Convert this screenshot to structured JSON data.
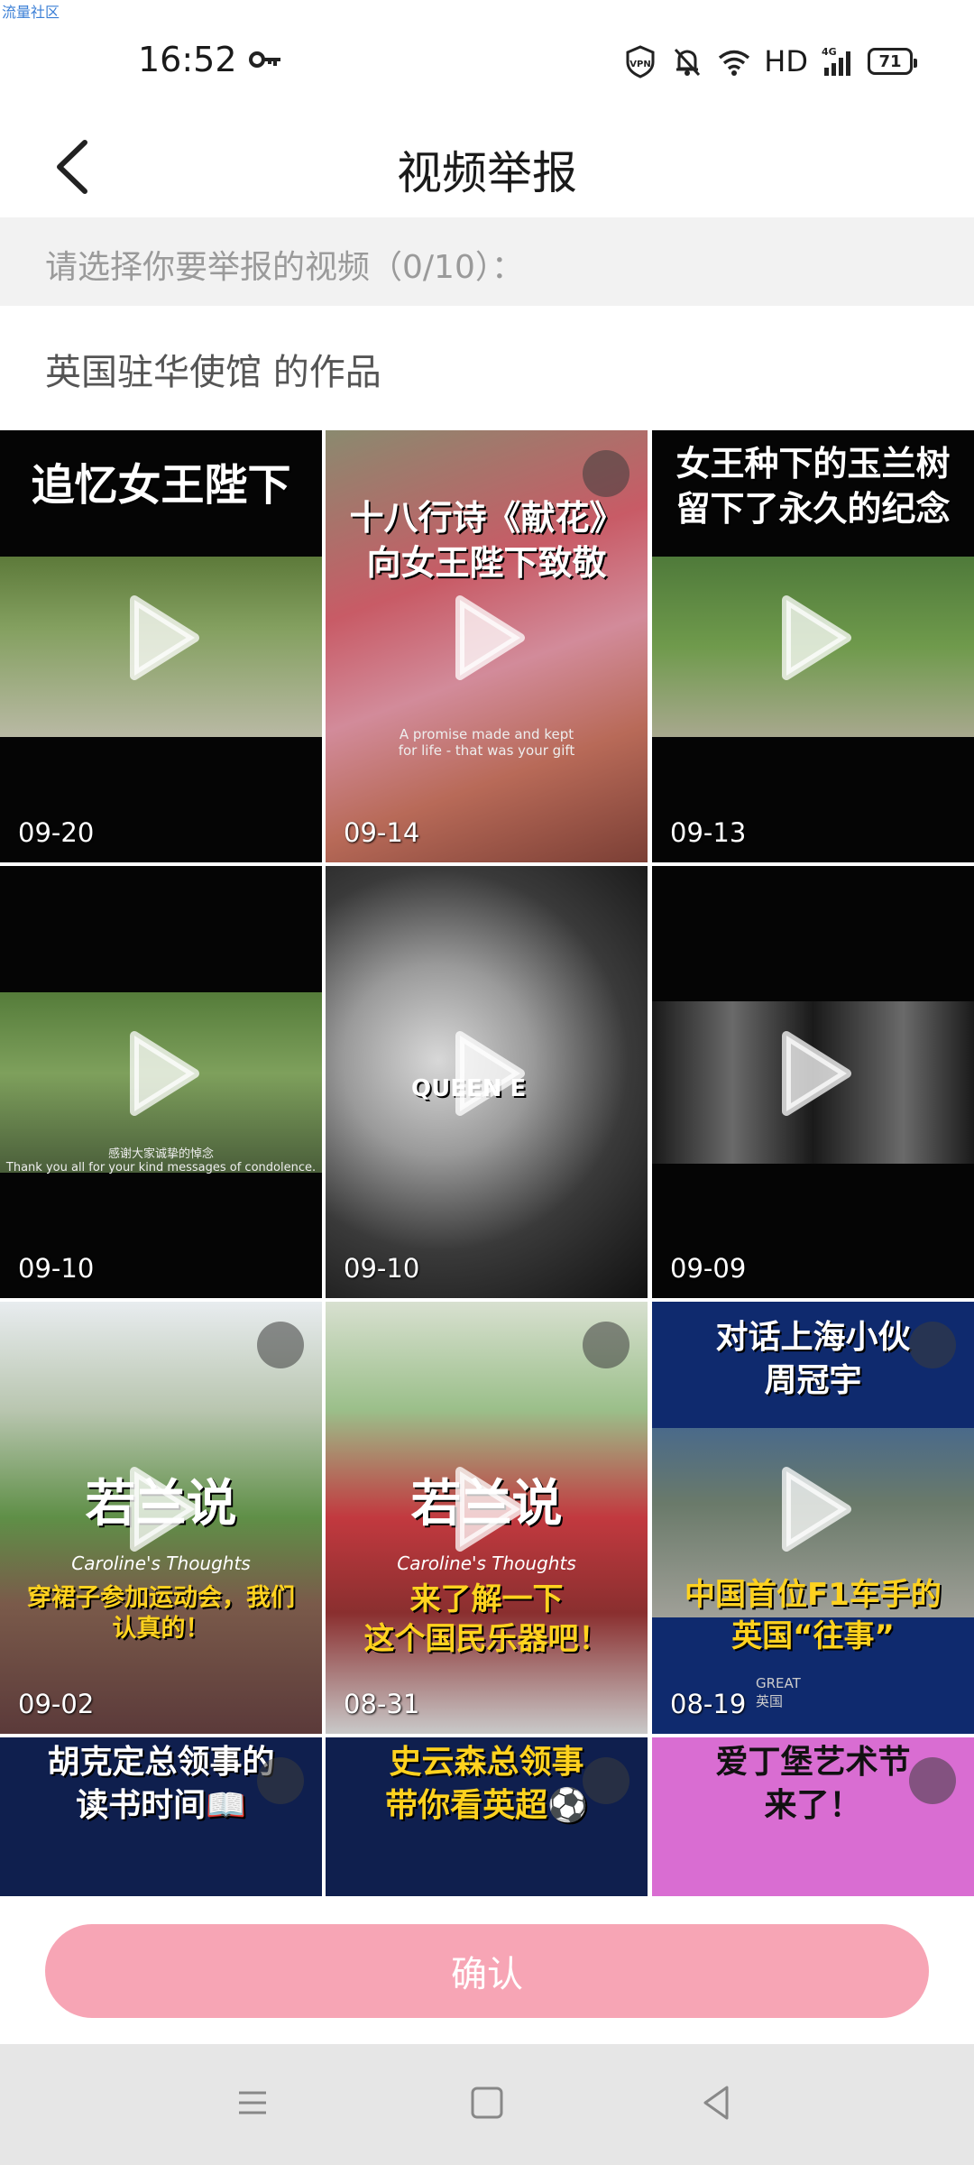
{
  "watermark": "流量社区",
  "status_bar": {
    "time": "16:52",
    "network": "HD",
    "signal": "4G",
    "battery": "71",
    "icons": [
      "key-icon",
      "vpn-icon",
      "bell-muted-icon",
      "wifi-icon",
      "signal-icon",
      "battery-icon"
    ]
  },
  "header": {
    "title": "视频举报"
  },
  "hint": "请选择你要举报的视频（0/10）：",
  "owner_label": "英国驻华使馆 的作品",
  "videos": [
    {
      "date": "09-20",
      "caption": "追忆女王陛下",
      "selectable": false
    },
    {
      "date": "09-14",
      "caption": "十八行诗《献花》\n向女王陛下致敬",
      "sub": "A promise made and kept\nfor life - that was your gift",
      "selectable": true
    },
    {
      "date": "09-13",
      "caption": "女王种下的玉兰树\n留下了永久的纪念",
      "selectable": false
    },
    {
      "date": "09-10",
      "caption": "",
      "sub": "感谢大家诚挚的悼念\nThank you all for your kind messages of condolence.",
      "selectable": false
    },
    {
      "date": "09-10",
      "caption": "QUEEN E",
      "selectable": false
    },
    {
      "date": "09-09",
      "caption": "",
      "selectable": false
    },
    {
      "date": "09-02",
      "caption": "若兰说",
      "sub": "Caroline's Thoughts",
      "caption2": "穿裙子参加运动会，我们\n认真的！",
      "selectable": true
    },
    {
      "date": "08-31",
      "caption": "若兰说",
      "sub": "Caroline's Thoughts",
      "caption2": "来了解一下\n这个国民乐器吧！",
      "selectable": true
    },
    {
      "date": "08-19",
      "caption": "对话上海小伙\n周冠宇",
      "caption2": "中国首位F1车手的\n英国“往事”",
      "brand": "GREAT\n英国",
      "selectable": true
    },
    {
      "date": "",
      "caption": "胡克定总领事的\n读书时间📖",
      "selectable": true
    },
    {
      "date": "",
      "caption": "史云森总领事\n带你看英超⚽",
      "selectable": true
    },
    {
      "date": "",
      "caption": "爱丁堡艺术节\n来了！",
      "selectable": true
    }
  ],
  "confirm_label": "确认",
  "nav": [
    "menu-icon",
    "home-icon",
    "back-triangle-icon"
  ]
}
